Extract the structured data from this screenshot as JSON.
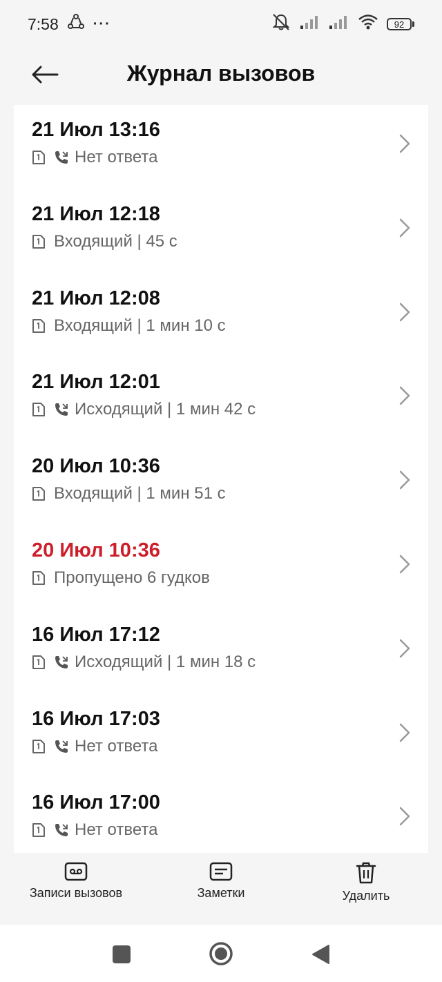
{
  "status": {
    "time": "7:58",
    "dots": "···",
    "battery": "92"
  },
  "header": {
    "title": "Журнал вызовов"
  },
  "calls": [
    {
      "time": "21 Июл 13:16",
      "detail": "Нет ответа",
      "phone_icon": true,
      "missed": false
    },
    {
      "time": "21 Июл 12:18",
      "detail": "Входящий | 45 с",
      "phone_icon": false,
      "missed": false
    },
    {
      "time": "21 Июл 12:08",
      "detail": "Входящий | 1 мин 10 с",
      "phone_icon": false,
      "missed": false
    },
    {
      "time": "21 Июл 12:01",
      "detail": "Исходящий | 1 мин 42 с",
      "phone_icon": true,
      "missed": false
    },
    {
      "time": "20 Июл 10:36",
      "detail": "Входящий | 1 мин 51 с",
      "phone_icon": false,
      "missed": false
    },
    {
      "time": "20 Июл 10:36",
      "detail": "Пропущено 6 гудков",
      "phone_icon": false,
      "missed": true
    },
    {
      "time": "16 Июл 17:12",
      "detail": "Исходящий | 1 мин 18 с",
      "phone_icon": true,
      "missed": false
    },
    {
      "time": "16 Июл 17:03",
      "detail": "Нет ответа",
      "phone_icon": true,
      "missed": false
    },
    {
      "time": "16 Июл 17:00",
      "detail": "Нет ответа",
      "phone_icon": true,
      "missed": false
    }
  ],
  "actions": {
    "recordings": "Записи вызовов",
    "notes": "Заметки",
    "delete": "Удалить"
  },
  "colors": {
    "missed": "#cc1e2b",
    "text": "#111111",
    "secondary": "#666666"
  }
}
